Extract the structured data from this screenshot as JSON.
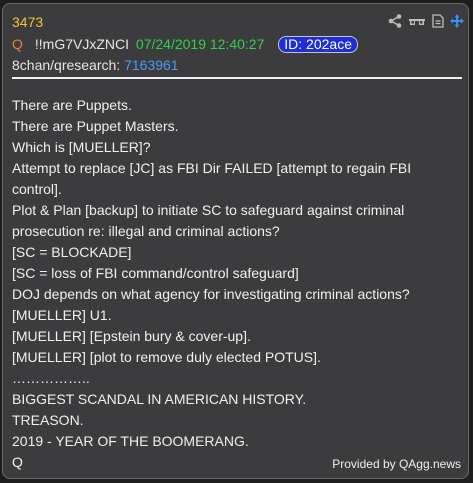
{
  "post": {
    "number": "3473",
    "author_mark": "Q",
    "tripcode": "!!mG7VJxZNCI",
    "datetime": "07/24/2019 12:40:27",
    "id_label": "ID: 202ace",
    "board": "8chan/qresearch:",
    "post_link": "7163961",
    "body_lines": [
      "There are Puppets.",
      "There are Puppet Masters.",
      "Which is [MUELLER]?",
      "Attempt to replace [JC] as FBI Dir FAILED [attempt to regain FBI",
      "control].",
      "Plot & Plan [backup] to initiate SC to safeguard against criminal",
      "prosecution re: illegal and criminal actions?",
      "[SC = BLOCKADE]",
      "[SC = loss of FBI command/control safeguard]",
      "DOJ depends on what agency for investigating criminal actions?",
      "[MUELLER] U1.",
      "[MUELLER] [Epstein bury & cover-up].",
      "[MUELLER] [plot to remove duly elected POTUS].",
      "……………..",
      "BIGGEST SCANDAL IN AMERICAN HISTORY.",
      "TREASON.",
      "2019 - YEAR OF THE BOOMERANG.",
      "Q"
    ]
  },
  "footer": {
    "credit": "Provided by QAgg.news"
  },
  "toolbar": {
    "icons": [
      "share-icon",
      "glasses-icon",
      "document-icon",
      "move-icon"
    ]
  },
  "colors": {
    "post_number": "#f4c430",
    "q_mark": "#e8833a",
    "date": "#31d14b",
    "id_badge": "#1f2fd8",
    "post_link": "#4a9bf4",
    "move_icon": "#3a8ef0"
  }
}
